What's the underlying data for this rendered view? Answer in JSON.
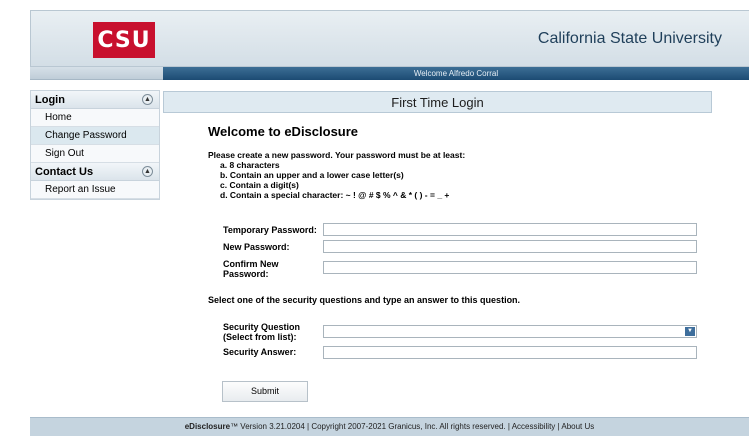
{
  "header": {
    "logo_text": "CSU",
    "university_title": "California State University"
  },
  "welcome_bar": {
    "text": "Welcome Alfredo Corral"
  },
  "sidebar": {
    "login_section": "Login",
    "items": [
      "Home",
      "Change Password",
      "Sign Out"
    ],
    "contact_section": "Contact Us",
    "contact_items": [
      "Report an Issue"
    ]
  },
  "main": {
    "panel_title": "First Time Login",
    "welcome_heading": "Welcome to eDisclosure",
    "password_intro": "Please create a new password. Your password must be at least:",
    "rules": [
      "a.  8 characters",
      "b.  Contain an upper and a lower case letter(s)",
      "c.  Contain a digit(s)",
      "d.  Contain a special character:  ~ ! @ # $ % ^ & * ( ) - = _ +"
    ],
    "labels": {
      "temporary_password": "Temporary Password:",
      "new_password": "New Password:",
      "confirm_password_1": "Confirm New",
      "confirm_password_2": "Password:",
      "security_instruction": "Select one of the security questions and type an answer to this question.",
      "security_question_1": "Security Question",
      "security_question_2": "(Select from list):",
      "security_answer": "Security Answer:"
    },
    "submit_label": "Submit"
  },
  "footer": {
    "brand": "eDisclosure",
    "brand_mark": "™",
    "rest": "  Version 3.21.0204  |  Copyright 2007-2021 Granicus, Inc.  All rights reserved.  |  Accessibility  |  About Us"
  },
  "colors": {
    "brand_red": "#c8102e",
    "bar_blue": "#1c4b73"
  }
}
